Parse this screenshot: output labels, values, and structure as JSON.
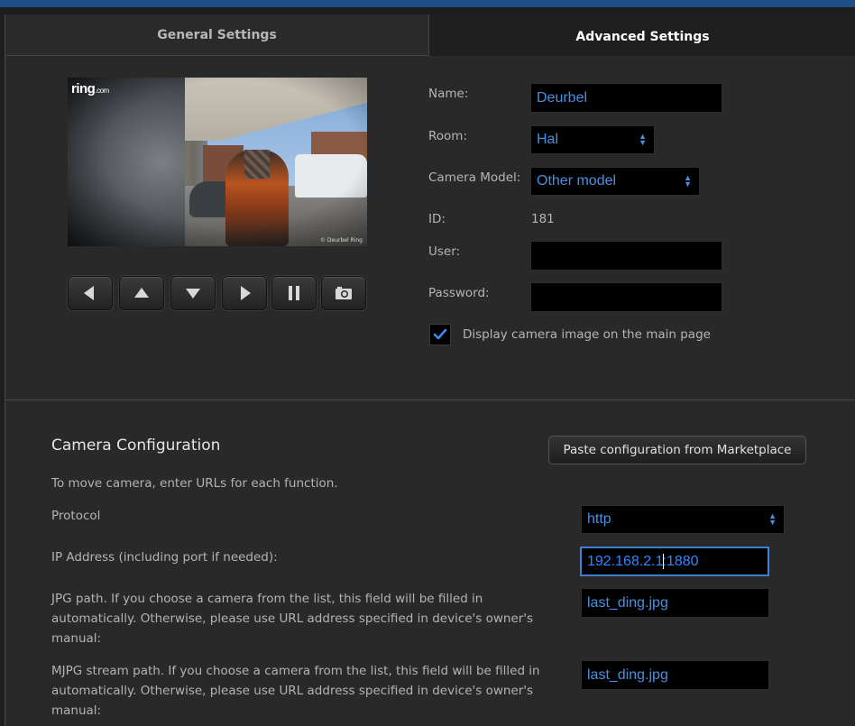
{
  "tabs": {
    "general": "General Settings",
    "advanced": "Advanced Settings"
  },
  "preview": {
    "logo": "ring",
    "logo_suffix": ".com",
    "stamp": "© Deurbel Ring"
  },
  "controls": [
    "left-arrow",
    "up-arrow",
    "down-arrow",
    "right-arrow",
    "pause",
    "snapshot"
  ],
  "form": {
    "name_label": "Name:",
    "name_value": "Deurbel",
    "room_label": "Room:",
    "room_value": "Hal",
    "model_label": "Camera Model:",
    "model_value": "Other model",
    "id_label": "ID:",
    "id_value": "181",
    "user_label": "User:",
    "user_value": "",
    "password_label": "Password:",
    "password_value": "",
    "display_checkbox_label": "Display camera image on the main page",
    "display_checked": true
  },
  "config": {
    "title": "Camera Configuration",
    "paste_button": "Paste configuration from Marketplace",
    "instruction": "To move camera, enter URLs for each function.",
    "protocol_label": "Protocol",
    "protocol_value": "http",
    "ip_label": "IP Address (including port if needed):",
    "ip_value_before_caret": "192.168.2.1",
    "ip_value_after_caret": ":1880",
    "jpg_label": "JPG path. If you choose a camera from the list, this field will be filled in automatically. Otherwise, please use URL address specified in device's owner's manual:",
    "jpg_value": "last_ding.jpg",
    "mjpg_label": "MJPG stream path. If you choose a camera from the list, this field will be filled in automatically. Otherwise, please use URL address specified in device's owner's manual:",
    "mjpg_value": "last_ding.jpg"
  },
  "colors": {
    "accent": "#4a90e2",
    "focus_border": "#3d7fd1",
    "topbar": "#1f4e86"
  }
}
